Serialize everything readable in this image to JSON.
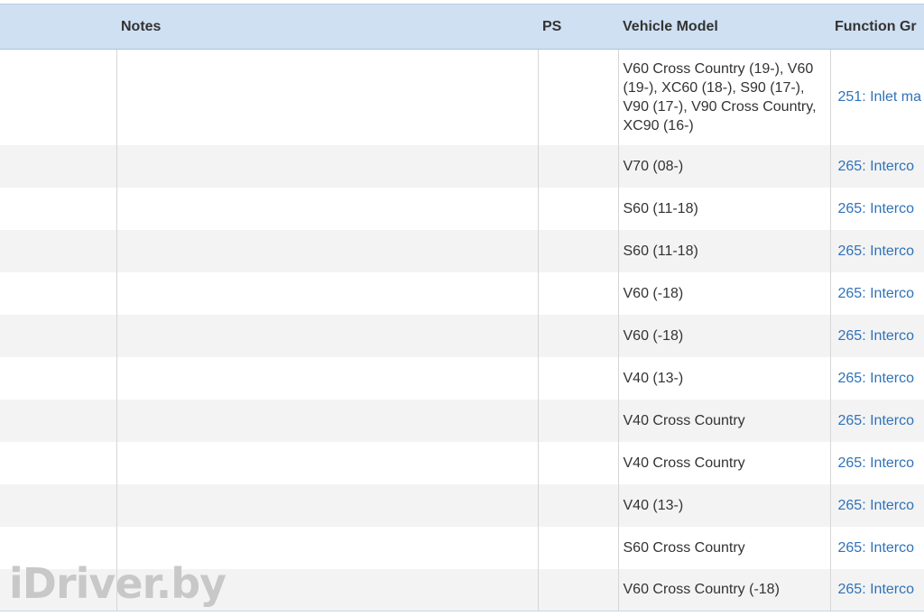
{
  "table": {
    "headers": [
      "",
      "Notes",
      "PS",
      "Vehicle Model",
      "Function Gr"
    ],
    "rows": [
      {
        "notes": "",
        "ps": "",
        "model": "V60 Cross Country (19-), V60 (19-), XC60 (18-), S90 (17-), V90 (17-), V90 Cross Country, XC90 (16-)",
        "fg_code": "251",
        "fg_text": ": Inlet ma"
      },
      {
        "notes": "",
        "ps": "",
        "model": "V70 (08-)",
        "fg_code": "265",
        "fg_text": ": Interco"
      },
      {
        "notes": "",
        "ps": "",
        "model": "S60 (11-18)",
        "fg_code": "265",
        "fg_text": ": Interco"
      },
      {
        "notes": "",
        "ps": "",
        "model": "S60 (11-18)",
        "fg_code": "265",
        "fg_text": ": Interco"
      },
      {
        "notes": "",
        "ps": "",
        "model": "V60 (-18)",
        "fg_code": "265",
        "fg_text": ": Interco"
      },
      {
        "notes": "",
        "ps": "",
        "model": "V60 (-18)",
        "fg_code": "265",
        "fg_text": ": Interco"
      },
      {
        "notes": "",
        "ps": "",
        "model": "V40 (13-)",
        "fg_code": "265",
        "fg_text": ": Interco"
      },
      {
        "notes": "",
        "ps": "",
        "model": "V40 Cross Country",
        "fg_code": "265",
        "fg_text": ": Interco"
      },
      {
        "notes": "",
        "ps": "",
        "model": "V40 Cross Country",
        "fg_code": "265",
        "fg_text": ": Interco"
      },
      {
        "notes": "",
        "ps": "",
        "model": "V40 (13-)",
        "fg_code": "265",
        "fg_text": ": Interco"
      },
      {
        "notes": "",
        "ps": "",
        "model": "S60 Cross Country",
        "fg_code": "265",
        "fg_text": ": Interco"
      },
      {
        "notes": "",
        "ps": "",
        "model": "V60 Cross Country (-18)",
        "fg_code": "265",
        "fg_text": ": Interco"
      }
    ]
  },
  "watermark": "iDriver.by",
  "colors": {
    "header_bg": "#cfe0f3",
    "link": "#2f72b8",
    "row_alt": "#f3f3f3",
    "text": "#333333"
  }
}
